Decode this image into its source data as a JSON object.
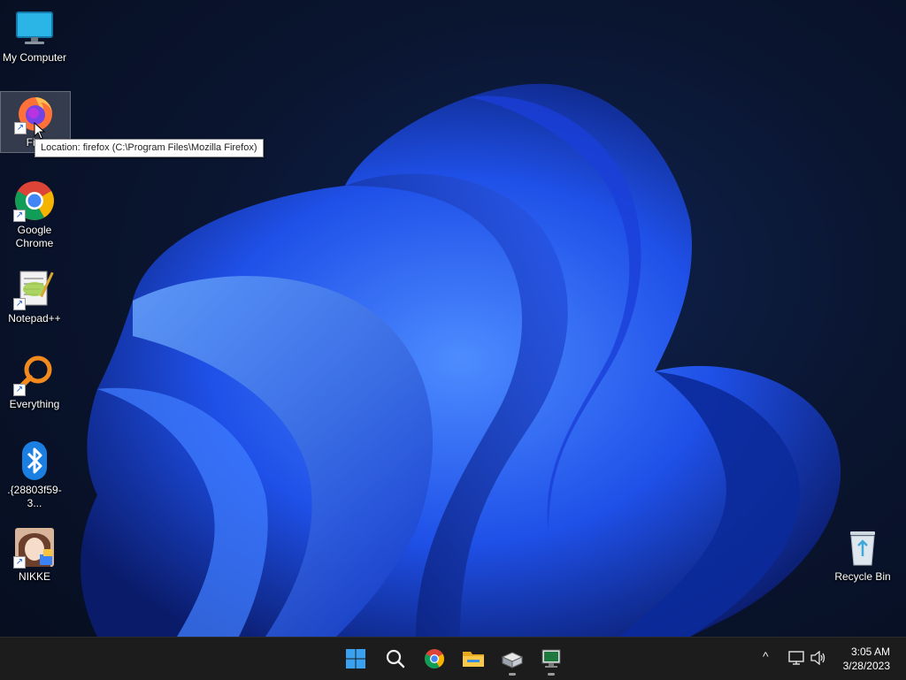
{
  "desktop": {
    "icons": [
      {
        "label": "My Computer"
      },
      {
        "label": "Fire"
      },
      {
        "label": "Google Chrome"
      },
      {
        "label": "Notepad++"
      },
      {
        "label": "Everything"
      },
      {
        "label": ".{28803f59-3..."
      },
      {
        "label": "NIKKE"
      },
      {
        "label": "Recycle Bin"
      }
    ],
    "tooltip": "Location: firefox (C:\\Program Files\\Mozilla Firefox)"
  },
  "taskbar": {
    "apps": [
      "start-icon",
      "search-icon",
      "chrome-icon",
      "file-explorer-icon",
      "app-icon",
      "terminal-app-icon"
    ],
    "tray": {
      "chevron": "^",
      "time": "3:05 AM",
      "date": "3/28/2023"
    }
  },
  "colors": {
    "taskbar": "#1c1c1c",
    "wallpaper_bloom": "#1f5bff",
    "accent": "#1a73e8"
  }
}
